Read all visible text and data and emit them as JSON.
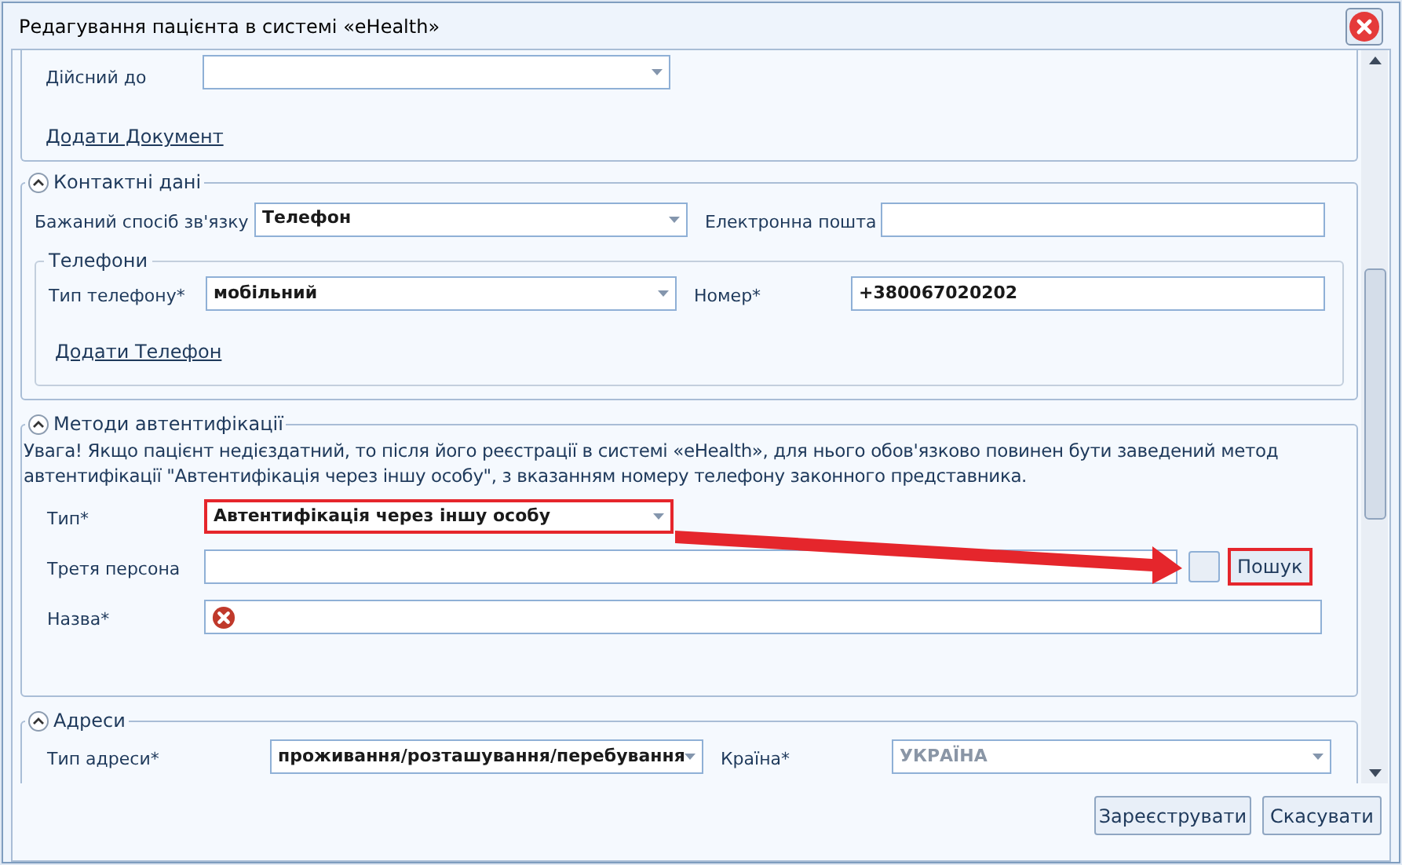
{
  "window": {
    "title": "Редагування пацієнта в системі «eHealth»"
  },
  "document_section": {
    "valid_until": {
      "label": "Дійсний до"
    },
    "add_link": "Додати Документ"
  },
  "contacts": {
    "title": "Контактні дані",
    "expanded": true,
    "preferred": {
      "label": "Бажаний спосіб зв'язку",
      "value": "Телефон"
    },
    "email": {
      "label": "Електронна пошта"
    },
    "phones": {
      "title": "Телефони",
      "type": {
        "label": "Тип телефону*",
        "value": "мобільний"
      },
      "number": {
        "label": "Номер*",
        "value": "+380067020202"
      },
      "add_link": "Додати Телефон"
    }
  },
  "auth": {
    "title": "Методи автентифікації",
    "expanded": true,
    "warning": "Увага! Якщо пацієнт недієздатний, то після його реєстрації в системі «eHealth», для нього обов'язково повинен бути заведений метод автентифікації \"Автентифікація через іншу особу\", з вказанням номеру телефону законного представника.",
    "type": {
      "label": "Тип*",
      "value": "Автентифікація через іншу особу",
      "highlighted": true
    },
    "third_person": {
      "label": "Третя персона",
      "search_button": "Пошук",
      "search_highlighted": true
    },
    "name": {
      "label": "Назва*",
      "error": true
    }
  },
  "addresses": {
    "title": "Адреси",
    "expanded": true,
    "type": {
      "label": "Тип адреси*",
      "value": "проживання/розташування/перебування"
    },
    "country": {
      "label": "Країна*",
      "value": "УКРАЇНА",
      "disabled": true
    }
  },
  "buttons": [
    "Зареєструвати",
    "Скасувати"
  ]
}
